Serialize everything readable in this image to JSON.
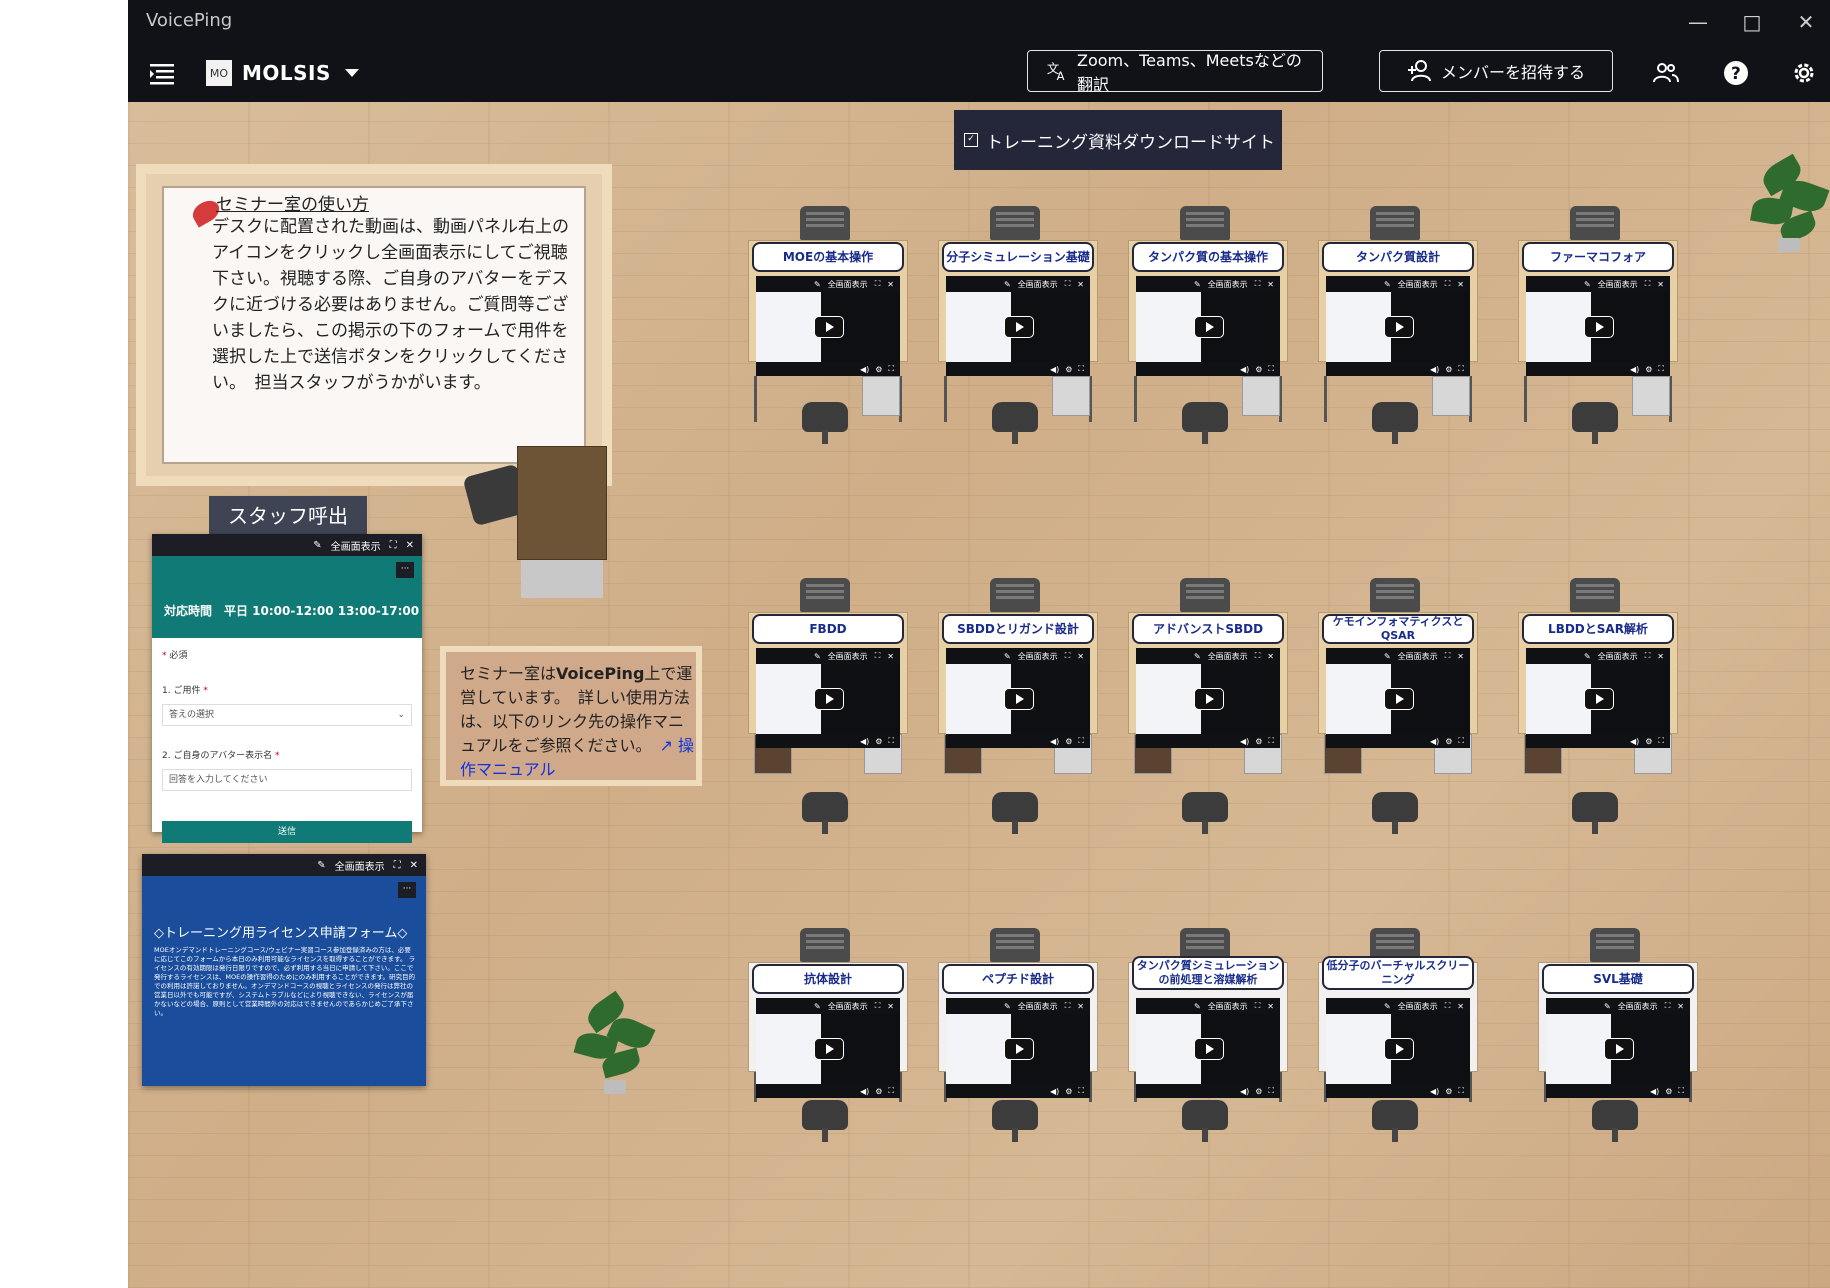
{
  "window": {
    "title": "VoicePing",
    "controls": {
      "minimize": "—",
      "maximize": "□",
      "close": "✕"
    }
  },
  "toolbar": {
    "org_badge": "MO",
    "org_name": "MOLSIS",
    "translate_label": "Zoom、Teams、Meetsなどの翻訳",
    "invite_label": "メンバーを招待する",
    "icons": [
      "sidebar-toggle-icon",
      "translate-icon",
      "add-person-icon",
      "people-icon",
      "help-icon",
      "gear-icon"
    ]
  },
  "room": {
    "banner": "トレーニング資料ダウンロードサイト",
    "notice": {
      "title": "セミナー室の使い方",
      "body": "デスクに配置された動画は、動画パネル右上のアイコンをクリックし全画面表示にしてご視聴下さい。視聴する際、ご自身のアバターをデスクに近づける必要はありません。ご質問等ございましたら、この掲示の下のフォームで用件を選択した上で送信ボタンをクリックしてください。　担当スタッフがうかがいます。"
    },
    "staff_label": "スタッフ呼出",
    "panel_header": {
      "fullscreen": "全画面表示"
    },
    "staff_form": {
      "hours": "対応時間　平日 10:00-12:00  13:00-17:00",
      "required": "必須",
      "q1": "1. ご用件",
      "q1_placeholder": "答えの選択",
      "q2": "2. ご自身のアバター表示名",
      "q2_placeholder": "回答を入力してください",
      "submit": "送信"
    },
    "license_form": {
      "title": "◇トレーニング用ライセンス申請フォーム◇",
      "body": "MOEオンデマンドトレーニングコース/ウェビナー実習コース参加登録済みの方は、必要に応じてこのフォームから本日のみ利用可能なライセンスを取得することができます。 ライセンスの有効期限は発行日限りですので、必ず利用する当日に申請して下さい。ここで発行するライセンスは、MOEの操作習得のためにのみ利用することができます。研究目的での利用は許諾しておりません。オンデマンドコースの視聴とライセンスの発行は弊社の営業日以外でも可能ですが、システムトラブルなどにより視聴できない、ライセンスが届かないなどの場合、原則として営業時間外の対応はできませんのであらかじめご了承下さい。",
      "notice_word": "注意事項"
    },
    "manual": {
      "text_a": "セミナー室は",
      "text_brand": "VoicePing",
      "text_b": "上で運営しています。　詳しい使用方法は、以下のリンク先の操作マニュアルをご参照ください。",
      "link": "操作マニュアル"
    },
    "desks": [
      {
        "label": "MOEの基本操作"
      },
      {
        "label": "分子シミュレーション基礎"
      },
      {
        "label": "タンパク質の基本操作"
      },
      {
        "label": "タンパク質設計"
      },
      {
        "label": "ファーマコフォア"
      },
      {
        "label": "FBDD"
      },
      {
        "label": "SBDDとリガンド設計"
      },
      {
        "label": "アドバンストSBDD"
      },
      {
        "label": "ケモインフォマティクスとQSAR"
      },
      {
        "label": "LBDDとSAR解析"
      },
      {
        "label": "抗体設計"
      },
      {
        "label": "ペプチド設計"
      },
      {
        "label": "タンパク質シミュレーションの前処理と溶媒解析"
      },
      {
        "label": "低分子のバーチャルスクリーニング"
      },
      {
        "label": "SVL基礎"
      }
    ],
    "video_controls": [
      "edit-icon",
      "fullscreen-icon",
      "close-icon",
      "play-icon",
      "volume-icon",
      "settings-icon"
    ]
  },
  "colors": {
    "titlebar": "#111218",
    "form_accent": "#0f7a76",
    "license_blue": "#1a4d9c",
    "label_text": "#1a2c8a",
    "link": "#1133dd"
  }
}
